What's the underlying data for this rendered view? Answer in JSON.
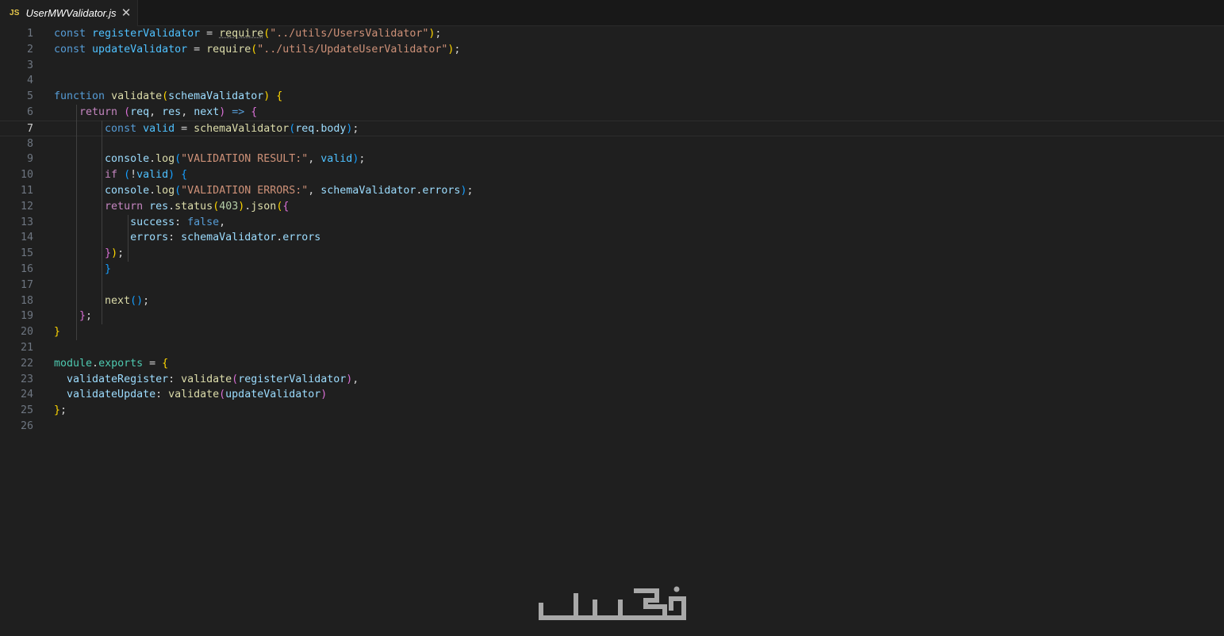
{
  "tab": {
    "icon_label": "JS",
    "title": "UserMWValidator.js",
    "close_glyph": "✕"
  },
  "editor": {
    "active_line": 7,
    "lines": [
      {
        "n": "1",
        "tokens": [
          [
            "kw",
            "const"
          ],
          [
            "op",
            " "
          ],
          [
            "cst",
            "registerValidator"
          ],
          [
            "op",
            " = "
          ],
          [
            "fnu",
            "require"
          ],
          [
            "b1",
            "("
          ],
          [
            "str",
            "\"../utils/UsersValidator\""
          ],
          [
            "b1",
            ")"
          ],
          [
            "op",
            ";"
          ]
        ]
      },
      {
        "n": "2",
        "tokens": [
          [
            "kw",
            "const"
          ],
          [
            "op",
            " "
          ],
          [
            "cst",
            "updateValidator"
          ],
          [
            "op",
            " = "
          ],
          [
            "fn",
            "require"
          ],
          [
            "b1",
            "("
          ],
          [
            "str",
            "\"../utils/UpdateUserValidator\""
          ],
          [
            "b1",
            ")"
          ],
          [
            "op",
            ";"
          ]
        ]
      },
      {
        "n": "3",
        "tokens": []
      },
      {
        "n": "4",
        "tokens": []
      },
      {
        "n": "5",
        "tokens": [
          [
            "kw",
            "function"
          ],
          [
            "op",
            " "
          ],
          [
            "fn",
            "validate"
          ],
          [
            "b1",
            "("
          ],
          [
            "var",
            "schemaValidator"
          ],
          [
            "b1",
            ")"
          ],
          [
            "op",
            " "
          ],
          [
            "b1",
            "{"
          ]
        ]
      },
      {
        "n": "6",
        "tokens": [
          [
            "op",
            "    "
          ],
          [
            "ctl",
            "return"
          ],
          [
            "op",
            " "
          ],
          [
            "b2",
            "("
          ],
          [
            "var",
            "req"
          ],
          [
            "op",
            ", "
          ],
          [
            "var",
            "res"
          ],
          [
            "op",
            ", "
          ],
          [
            "var",
            "next"
          ],
          [
            "b2",
            ")"
          ],
          [
            "op",
            " "
          ],
          [
            "kw",
            "=>"
          ],
          [
            "op",
            " "
          ],
          [
            "b2",
            "{"
          ]
        ]
      },
      {
        "n": "7",
        "tokens": [
          [
            "op",
            "        "
          ],
          [
            "kw",
            "const"
          ],
          [
            "op",
            " "
          ],
          [
            "cst",
            "valid"
          ],
          [
            "op",
            " = "
          ],
          [
            "fn",
            "schemaValidator"
          ],
          [
            "b3",
            "("
          ],
          [
            "var",
            "req"
          ],
          [
            "op",
            "."
          ],
          [
            "var",
            "body"
          ],
          [
            "b3",
            ")"
          ],
          [
            "op",
            ";"
          ]
        ]
      },
      {
        "n": "8",
        "tokens": []
      },
      {
        "n": "9",
        "tokens": [
          [
            "op",
            "        "
          ],
          [
            "var",
            "console"
          ],
          [
            "op",
            "."
          ],
          [
            "fn",
            "log"
          ],
          [
            "b3",
            "("
          ],
          [
            "str",
            "\"VALIDATION RESULT:\""
          ],
          [
            "op",
            ", "
          ],
          [
            "cst",
            "valid"
          ],
          [
            "b3",
            ")"
          ],
          [
            "op",
            ";"
          ]
        ]
      },
      {
        "n": "10",
        "tokens": [
          [
            "op",
            "        "
          ],
          [
            "ctl",
            "if"
          ],
          [
            "op",
            " "
          ],
          [
            "b3",
            "("
          ],
          [
            "op",
            "!"
          ],
          [
            "cst",
            "valid"
          ],
          [
            "b3",
            ")"
          ],
          [
            "op",
            " "
          ],
          [
            "b3",
            "{"
          ]
        ]
      },
      {
        "n": "11",
        "tokens": [
          [
            "op",
            "        "
          ],
          [
            "var",
            "console"
          ],
          [
            "op",
            "."
          ],
          [
            "fn",
            "log"
          ],
          [
            "b3",
            "("
          ],
          [
            "str",
            "\"VALIDATION ERRORS:\""
          ],
          [
            "op",
            ", "
          ],
          [
            "var",
            "schemaValidator"
          ],
          [
            "op",
            "."
          ],
          [
            "var",
            "errors"
          ],
          [
            "b3",
            ")"
          ],
          [
            "op",
            ";"
          ]
        ]
      },
      {
        "n": "12",
        "tokens": [
          [
            "op",
            "        "
          ],
          [
            "ctl",
            "return"
          ],
          [
            "op",
            " "
          ],
          [
            "var",
            "res"
          ],
          [
            "op",
            "."
          ],
          [
            "fn",
            "status"
          ],
          [
            "b1",
            "("
          ],
          [
            "num",
            "403"
          ],
          [
            "b1",
            ")"
          ],
          [
            "op",
            "."
          ],
          [
            "fn",
            "json"
          ],
          [
            "b1",
            "("
          ],
          [
            "b2",
            "{"
          ]
        ]
      },
      {
        "n": "13",
        "tokens": [
          [
            "op",
            "            "
          ],
          [
            "var",
            "success"
          ],
          [
            "op",
            ": "
          ],
          [
            "kw",
            "false"
          ],
          [
            "op",
            ","
          ]
        ]
      },
      {
        "n": "14",
        "tokens": [
          [
            "op",
            "            "
          ],
          [
            "var",
            "errors"
          ],
          [
            "op",
            ": "
          ],
          [
            "var",
            "schemaValidator"
          ],
          [
            "op",
            "."
          ],
          [
            "var",
            "errors"
          ]
        ]
      },
      {
        "n": "15",
        "tokens": [
          [
            "op",
            "        "
          ],
          [
            "b2",
            "}"
          ],
          [
            "b1",
            ")"
          ],
          [
            "op",
            ";"
          ]
        ]
      },
      {
        "n": "16",
        "tokens": [
          [
            "op",
            "        "
          ],
          [
            "b3",
            "}"
          ]
        ]
      },
      {
        "n": "17",
        "tokens": []
      },
      {
        "n": "18",
        "tokens": [
          [
            "op",
            "        "
          ],
          [
            "fn",
            "next"
          ],
          [
            "b3",
            "()"
          ],
          [
            "op",
            ";"
          ]
        ]
      },
      {
        "n": "19",
        "tokens": [
          [
            "op",
            "    "
          ],
          [
            "b2",
            "}"
          ],
          [
            "op",
            ";"
          ]
        ]
      },
      {
        "n": "20",
        "tokens": [
          [
            "b1",
            "}"
          ]
        ]
      },
      {
        "n": "21",
        "tokens": []
      },
      {
        "n": "22",
        "tokens": [
          [
            "obj",
            "module"
          ],
          [
            "op",
            "."
          ],
          [
            "obj",
            "exports"
          ],
          [
            "op",
            " = "
          ],
          [
            "b1",
            "{"
          ]
        ]
      },
      {
        "n": "23",
        "tokens": [
          [
            "op",
            "  "
          ],
          [
            "var",
            "validateRegister"
          ],
          [
            "op",
            ": "
          ],
          [
            "fn",
            "validate"
          ],
          [
            "b2",
            "("
          ],
          [
            "var",
            "registerValidator"
          ],
          [
            "b2",
            ")"
          ],
          [
            "op",
            ","
          ]
        ]
      },
      {
        "n": "24",
        "tokens": [
          [
            "op",
            "  "
          ],
          [
            "var",
            "validateUpdate"
          ],
          [
            "op",
            ": "
          ],
          [
            "fn",
            "validate"
          ],
          [
            "b2",
            "("
          ],
          [
            "var",
            "updateValidator"
          ],
          [
            "b2",
            ")"
          ]
        ]
      },
      {
        "n": "25",
        "tokens": [
          [
            "b1",
            "}"
          ],
          [
            "op",
            ";"
          ]
        ]
      },
      {
        "n": "26",
        "tokens": []
      }
    ]
  },
  "watermark": {
    "brand_name": "خمسات"
  },
  "colors": {
    "background": "#1f1f1f",
    "tab_bar": "#181818",
    "line_number": "#6e7681",
    "active_line_number": "#cccccc",
    "keyword": "#569cd6",
    "string": "#ce9178",
    "function": "#dcdcaa",
    "watermark": "#a8a8a8"
  }
}
